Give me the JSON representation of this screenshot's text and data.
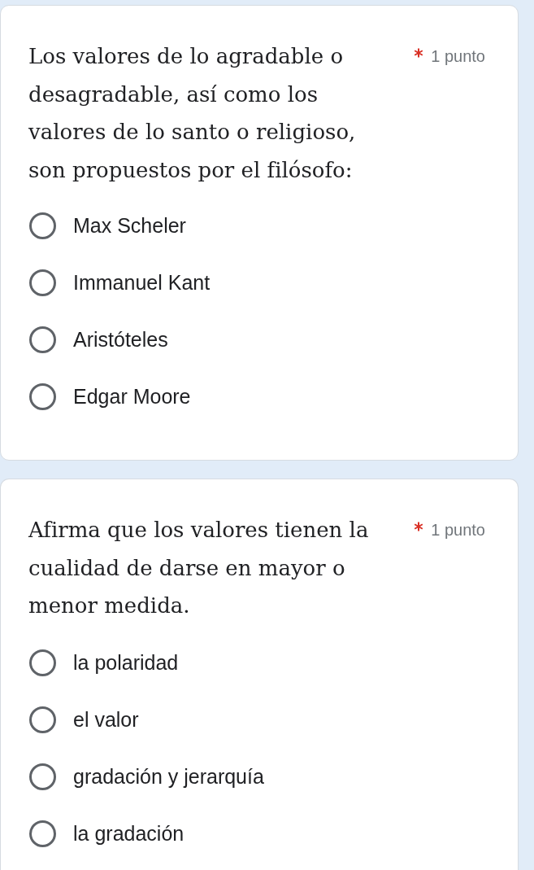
{
  "questions": [
    {
      "title": "Los valores de lo agradable o desagradable, así como los valores de lo santo o religioso, son propuestos por el filósofo:",
      "required": true,
      "points": "1 punto",
      "options": [
        {
          "label": "Max Scheler",
          "selected": false
        },
        {
          "label": "Immanuel Kant",
          "selected": false
        },
        {
          "label": "Aristóteles",
          "selected": false
        },
        {
          "label": "Edgar Moore",
          "selected": false
        }
      ]
    },
    {
      "title": "Afirma que los valores tienen la cualidad de darse en mayor o menor medida.",
      "required": true,
      "points": "1 punto",
      "options": [
        {
          "label": "la polaridad",
          "selected": false
        },
        {
          "label": "el valor",
          "selected": false
        },
        {
          "label": "gradación y jerarquía",
          "selected": false
        },
        {
          "label": "la gradación",
          "selected": false
        }
      ]
    }
  ]
}
